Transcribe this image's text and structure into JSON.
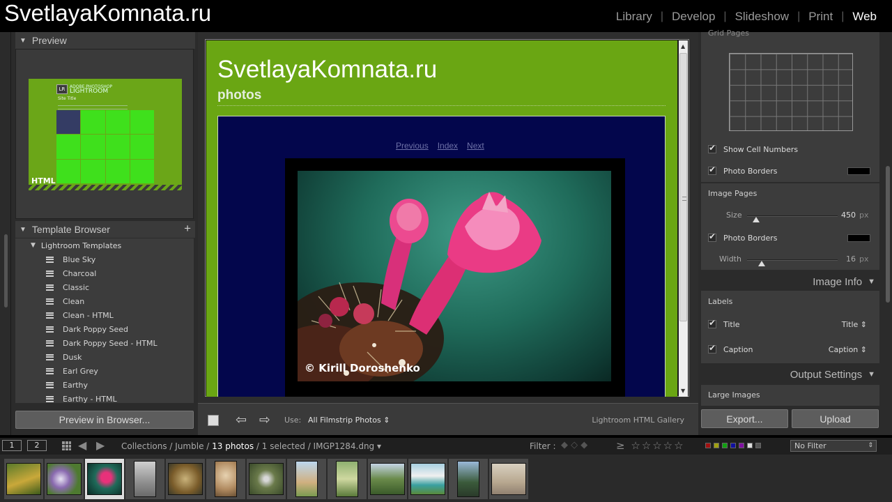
{
  "app": {
    "brand": "SvetlayaKomnata.ru",
    "modules": [
      "Library",
      "Develop",
      "Slideshow",
      "Print",
      "Web"
    ],
    "active_module": "Web"
  },
  "left": {
    "preview_title": "Preview",
    "thumb_badge": "HTML",
    "thumb_logo": "LR",
    "thumb_logo_text_small": "ADOBE PHOTOSHOP",
    "thumb_logo_text": "LIGHTROOM",
    "thumb_site_title": "Site Title",
    "template_browser_title": "Template Browser",
    "folder": "Lightroom Templates",
    "templates": [
      "Blue Sky",
      "Charcoal",
      "Classic",
      "Clean",
      "Clean - HTML",
      "Dark Poppy Seed",
      "Dark Poppy Seed - HTML",
      "Dusk",
      "Earl Grey",
      "Earthy",
      "Earthy - HTML"
    ],
    "preview_button": "Preview in Browser..."
  },
  "center": {
    "site_title": "SvetlayaKomnata.ru",
    "site_subtitle": "photos",
    "nav": [
      "Previous",
      "Index",
      "Next"
    ],
    "photo_credit": "© Kirill Doroshenko",
    "use_label": "Use:",
    "use_value": "All Filmstrip Photos",
    "gallery_name": "Lightroom HTML Gallery"
  },
  "right": {
    "grid_pages_title": "Grid Pages",
    "show_cell_numbers": "Show Cell Numbers",
    "photo_borders": "Photo Borders",
    "image_pages_title": "Image Pages",
    "size_label": "Size",
    "size_value": "450",
    "size_unit": "px",
    "size_fraction": 0.1,
    "photo_borders_2": "Photo Borders",
    "width_label": "Width",
    "width_value": "16",
    "width_unit": "px",
    "width_fraction": 0.16,
    "image_info_title": "Image Info",
    "labels_title": "Labels",
    "title_label": "Title",
    "title_value": "Title",
    "caption_label": "Caption",
    "caption_value": "Caption",
    "output_settings_title": "Output Settings",
    "large_images": "Large Images",
    "export_button": "Export...",
    "upload_button": "Upload"
  },
  "filmbar": {
    "monitor1": "1",
    "monitor2": "2",
    "crumb_collections": "Collections / Jumble /",
    "crumb_count": "13 photos",
    "crumb_rest": "/ 1 selected / IMGP1284.dng",
    "filter_label": "Filter :",
    "no_filter": "No Filter"
  },
  "colors": {
    "accent_green": "#6aa613",
    "navy": "#03064c",
    "flower_pink": "#e8317a"
  }
}
